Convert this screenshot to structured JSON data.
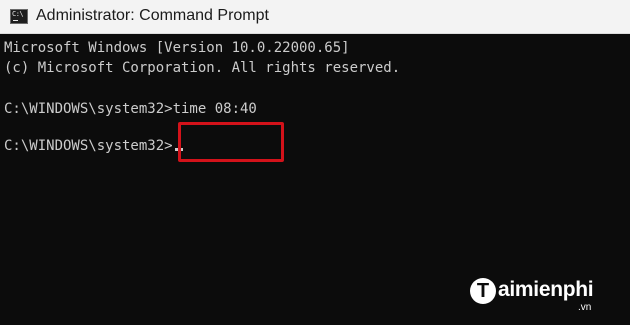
{
  "window": {
    "title": "Administrator: Command Prompt",
    "icon": "cmd-icon",
    "icon_text": "C:\\"
  },
  "console": {
    "lines": [
      "Microsoft Windows [Version 10.0.22000.65]",
      "(c) Microsoft Corporation. All rights reserved.",
      "C:\\WINDOWS\\system32>time 08:40",
      "C:\\WINDOWS\\system32>"
    ]
  },
  "annotation": {
    "highlight_color": "#d3121a"
  },
  "watermark": {
    "initial": "T",
    "name": "aimienphi",
    "suffix": ".vn"
  },
  "colors": {
    "background": "#0c0c0c",
    "text": "#cccccc",
    "titlebar": "#f3f3f3"
  }
}
